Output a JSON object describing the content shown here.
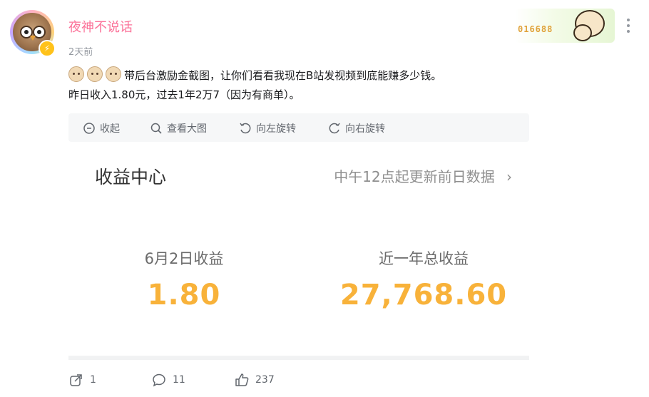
{
  "author": {
    "name": "夜神不说话",
    "time": "2天前"
  },
  "decoration": {
    "number": "016688"
  },
  "post": {
    "line1": "带后台激励金截图，让你们看看我现在B站发视频到底能赚多少钱。",
    "line2": "昨日收入1.80元，过去1年2万7（因为有商单）。"
  },
  "image_toolbar": {
    "collapse": "收起",
    "view_large": "查看大图",
    "rotate_left": "向左旋转",
    "rotate_right": "向右旋转"
  },
  "earnings": {
    "title": "收益中心",
    "hint": "中午12点起更新前日数据",
    "daily_label": "6月2日收益",
    "daily_value": "1.80",
    "yearly_label": "近一年总收益",
    "yearly_value": "27,768.60"
  },
  "actions": {
    "share_count": "1",
    "comment_count": "11",
    "like_count": "237"
  },
  "colors": {
    "username": "#fb7299",
    "earnings_value": "#f8b23a"
  }
}
